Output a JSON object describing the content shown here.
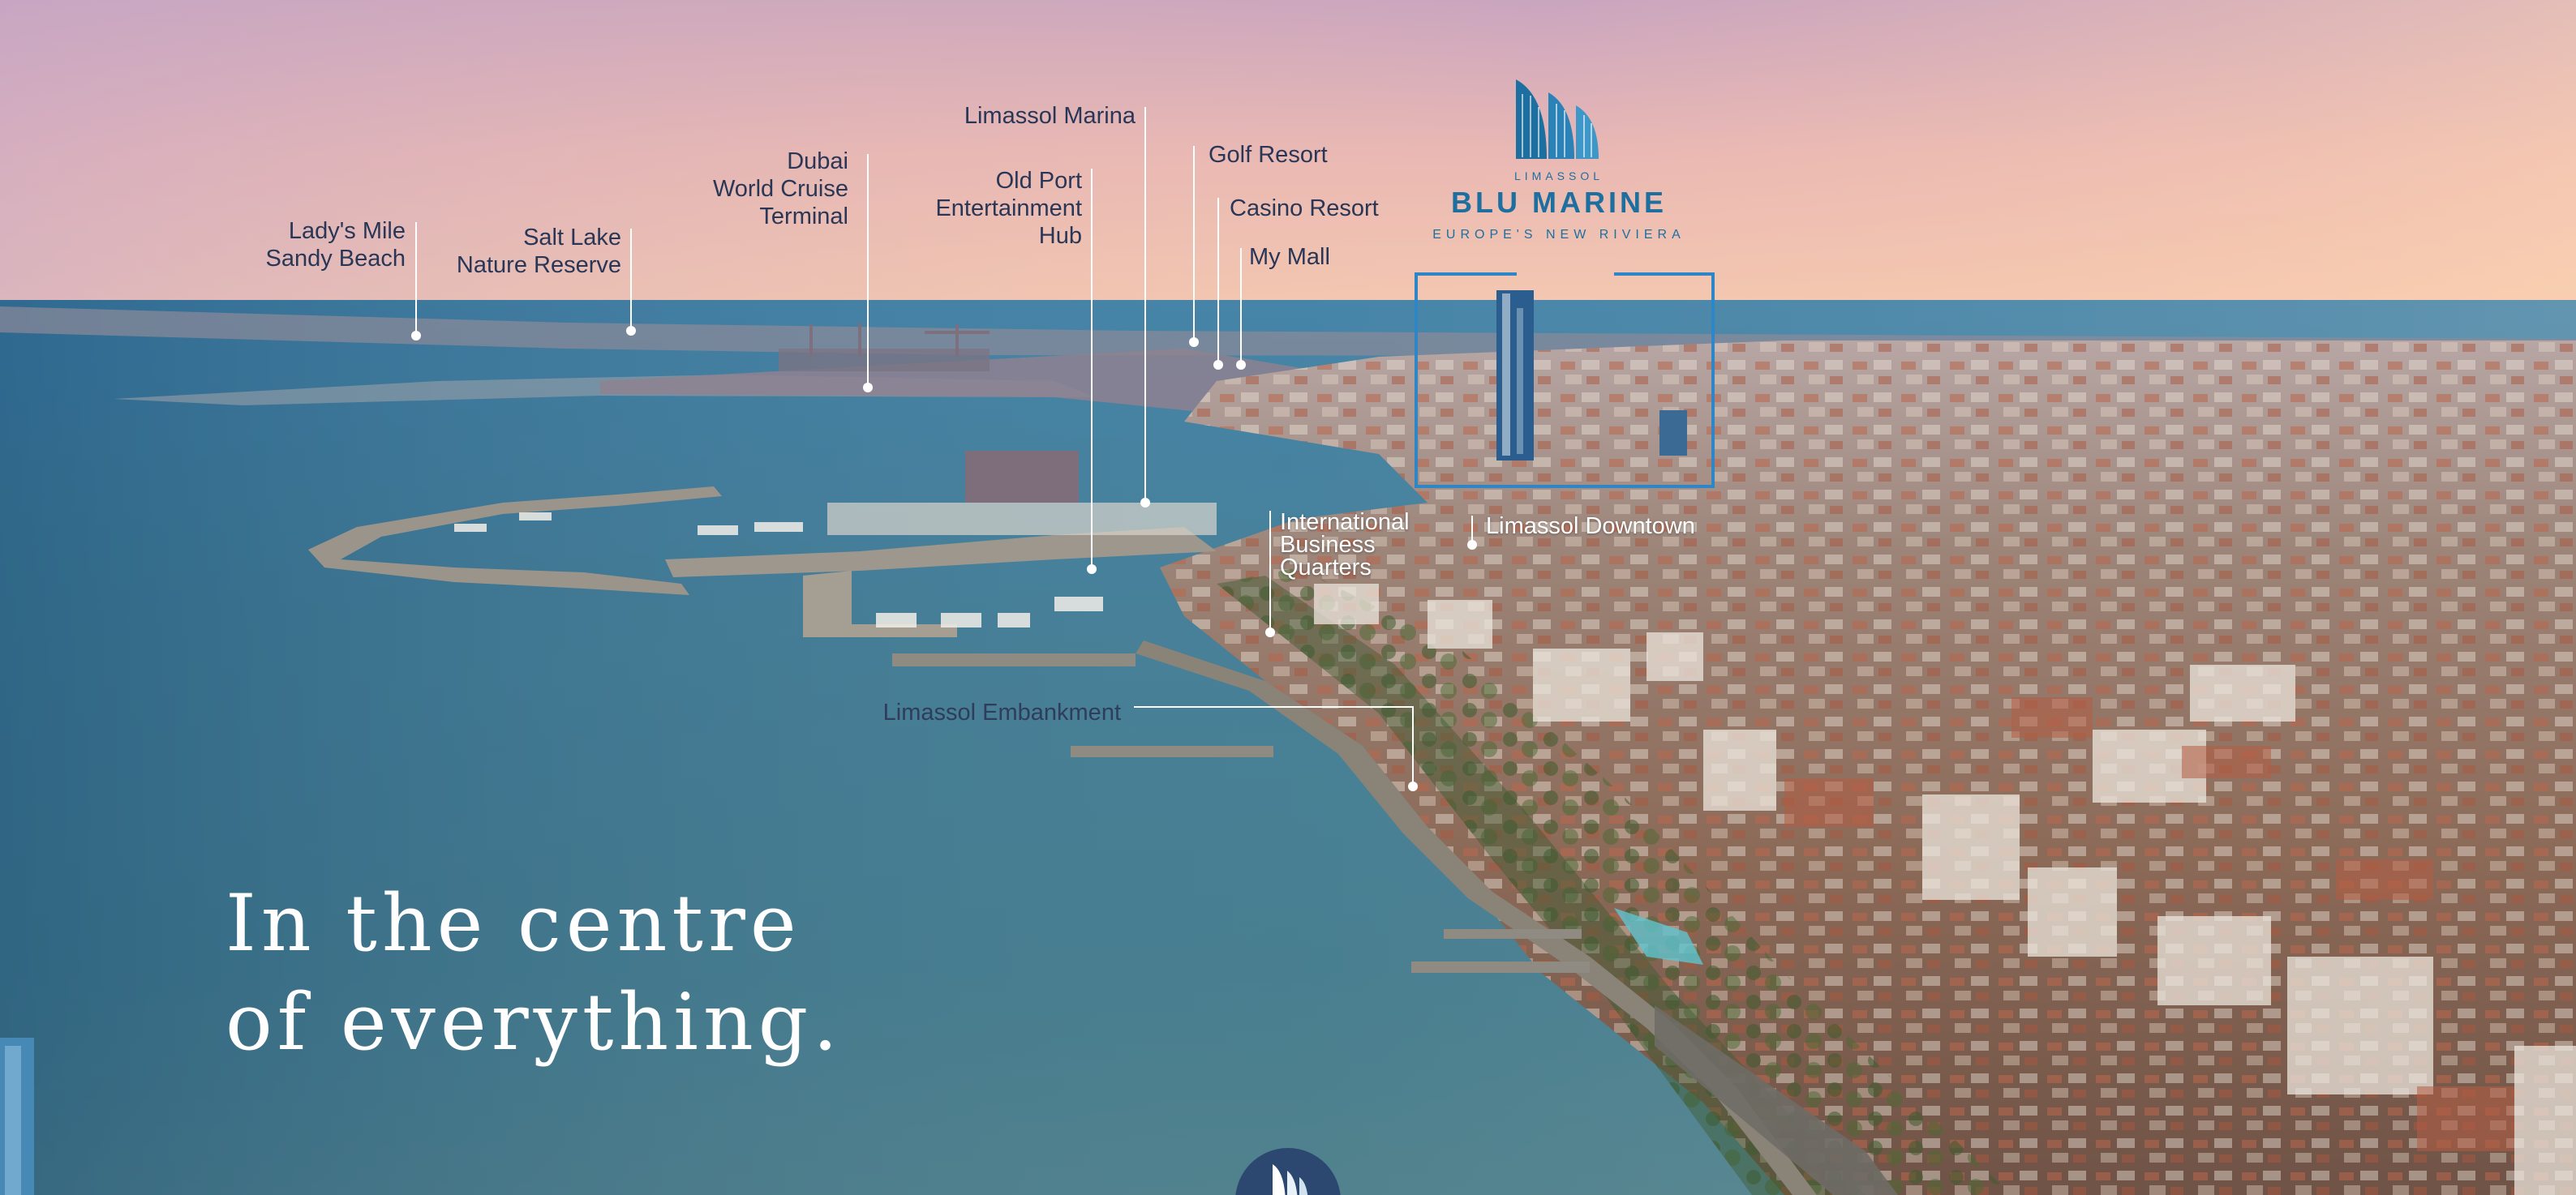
{
  "headline": {
    "line1": "In the centre",
    "line2": "of everything."
  },
  "brand": {
    "top": "LIMASSOL",
    "name": "BLU MARINE",
    "tagline": "EUROPE'S NEW RIVIERA",
    "color": "#1d6fa0"
  },
  "locations": {
    "ladys_mile": {
      "line1": "Lady's Mile",
      "line2": "Sandy Beach"
    },
    "salt_lake": {
      "line1": "Salt Lake",
      "line2": "Nature Reserve"
    },
    "dubai_terminal": {
      "line1": "Dubai",
      "line2": "World Cruise",
      "line3": "Terminal"
    },
    "limassol_marina": {
      "line1": "Limassol Marina"
    },
    "old_port": {
      "line1": "Old Port",
      "line2": "Entertainment",
      "line3": "Hub"
    },
    "golf_resort": {
      "line1": "Golf Resort"
    },
    "casino_resort": {
      "line1": "Casino Resort"
    },
    "my_mall": {
      "line1": "My Mall"
    },
    "ibq": {
      "line1": "International",
      "line2": "Business",
      "line3": "Quarters"
    },
    "downtown": {
      "line1": "Limassol Downtown"
    },
    "embankment": {
      "line1": "Limassol Embankment"
    }
  },
  "icons": {
    "brand_logo": "sail-logo-icon",
    "bottom": "sail-logo-icon"
  }
}
